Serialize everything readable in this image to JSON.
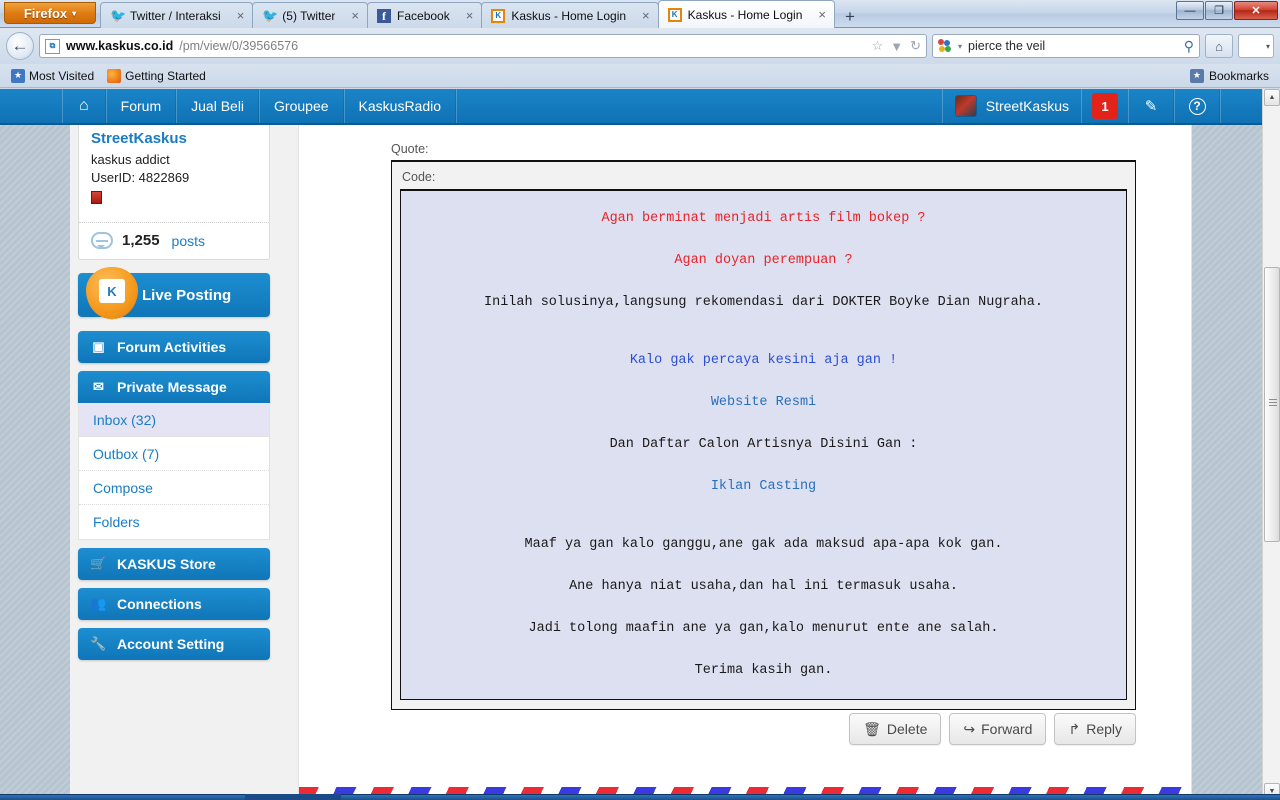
{
  "browser": {
    "app_button": {
      "label": "Firefox",
      "caret": "▾"
    },
    "tabs": [
      {
        "title": "Twitter / Interaksi",
        "favicon": "twitter-icon",
        "close": "×",
        "active": false
      },
      {
        "title": "(5) Twitter",
        "favicon": "twitter-icon",
        "close": "×",
        "active": false
      },
      {
        "title": "Facebook",
        "favicon": "facebook-icon",
        "close": "×",
        "active": false
      },
      {
        "title": "Kaskus - Home Login",
        "favicon": "kaskus-icon",
        "close": "×",
        "active": false
      },
      {
        "title": "Kaskus - Home Login",
        "favicon": "kaskus-icon",
        "close": "×",
        "active": true
      }
    ],
    "new_tab_label": "+",
    "window_controls": {
      "minimize": "—",
      "maximize": "❐",
      "close": "✕"
    },
    "back_label": "←",
    "url": {
      "host": "www.kaskus.co.id",
      "path": "/pm/view/0/39566576",
      "favicon_text": "⧉"
    },
    "url_icons": {
      "bookmark": "☆",
      "dropdown": "▼",
      "reload": "↻"
    },
    "search": {
      "value": "pierce the veil",
      "engine": "google-icon",
      "caret": "▾",
      "magnifier": "⚲"
    },
    "home_icon": "⌂",
    "blank_button_caret": "▾",
    "bookmarks": [
      {
        "label": "Most Visited",
        "icon": "most-visited-icon"
      },
      {
        "label": "Getting Started",
        "icon": "firefox-icon"
      }
    ],
    "bookmarks_toolbar_label": "Bookmarks",
    "bookmarks_toolbar_icon": "star-folder-icon"
  },
  "site_nav": {
    "home_icon": "⌂",
    "items": [
      "Forum",
      "Jual Beli",
      "Groupee",
      "KaskusRadio"
    ],
    "username": "StreetKaskus",
    "notification_count": "1",
    "compose_icon": "✎",
    "help_icon": "?"
  },
  "sidebar": {
    "user": {
      "name": "StreetKaskus",
      "rank": "kaskus addict",
      "userid_label": "UserID: 4822869",
      "posts_count": "1,255",
      "posts_label": "posts"
    },
    "buttons": [
      {
        "label": "Live Posting",
        "icon": "kaskus-pin-icon"
      },
      {
        "label": "Forum Activities",
        "icon": "list-icon"
      },
      {
        "label": "Private Message",
        "icon": "envelope-icon"
      }
    ],
    "pm_submenu": [
      {
        "label": "Inbox (32)",
        "selected": true
      },
      {
        "label": "Outbox (7)",
        "selected": false
      },
      {
        "label": "Compose",
        "selected": false
      },
      {
        "label": "Folders",
        "selected": false
      }
    ],
    "bottom_buttons": [
      {
        "label": "KASKUS Store",
        "icon": "cart-icon"
      },
      {
        "label": "Connections",
        "icon": "people-icon"
      },
      {
        "label": "Account Setting",
        "icon": "wrench-icon"
      }
    ]
  },
  "message": {
    "quote_label": "Quote:",
    "code_label": "Code:",
    "lines": [
      {
        "text": "Agan berminat menjadi artis film bokep ?",
        "style": "red"
      },
      {
        "text": "",
        "style": "gap-s"
      },
      {
        "text": "Agan doyan perempuan ?",
        "style": "red"
      },
      {
        "text": "",
        "style": "gap-s"
      },
      {
        "text": "Inilah solusinya,langsung rekomendasi dari DOKTER Boyke Dian Nugraha.",
        "style": "plain"
      },
      {
        "text": "",
        "style": "gap"
      },
      {
        "text": "Kalo gak percaya kesini aja gan !",
        "style": "blue"
      },
      {
        "text": "",
        "style": "gap-s"
      },
      {
        "text": "Website Resmi",
        "style": "link"
      },
      {
        "text": "",
        "style": "gap-s"
      },
      {
        "text": "Dan Daftar Calon Artisnya Disini Gan :",
        "style": "plain"
      },
      {
        "text": "",
        "style": "gap-s"
      },
      {
        "text": "Iklan Casting",
        "style": "link"
      },
      {
        "text": "",
        "style": "gap"
      },
      {
        "text": "Maaf ya gan kalo ganggu,ane gak ada maksud apa-apa kok gan.",
        "style": "plain"
      },
      {
        "text": "",
        "style": "gap-s"
      },
      {
        "text": "Ane hanya niat usaha,dan hal ini termasuk usaha.",
        "style": "plain"
      },
      {
        "text": "",
        "style": "gap-s"
      },
      {
        "text": "Jadi tolong maafin ane ya gan,kalo menurut ente ane salah.",
        "style": "plain"
      },
      {
        "text": "",
        "style": "gap-s"
      },
      {
        "text": "Terima kasih gan.",
        "style": "plain"
      }
    ],
    "actions": [
      {
        "label": "Delete",
        "icon": "🗑"
      },
      {
        "label": "Forward",
        "icon": "↪"
      },
      {
        "label": "Reply",
        "icon": "↱"
      }
    ]
  },
  "colors": {
    "kaskus_blue": "#1080c4",
    "accent_orange": "#ef9518",
    "badge_red": "#e2231a",
    "code_bg": "#dde0f0",
    "link_blue": "#2a6fbd",
    "quote_red": "#e8232a",
    "quote_blue": "#2b4fd6",
    "page_bg": "#b5c4ce"
  }
}
